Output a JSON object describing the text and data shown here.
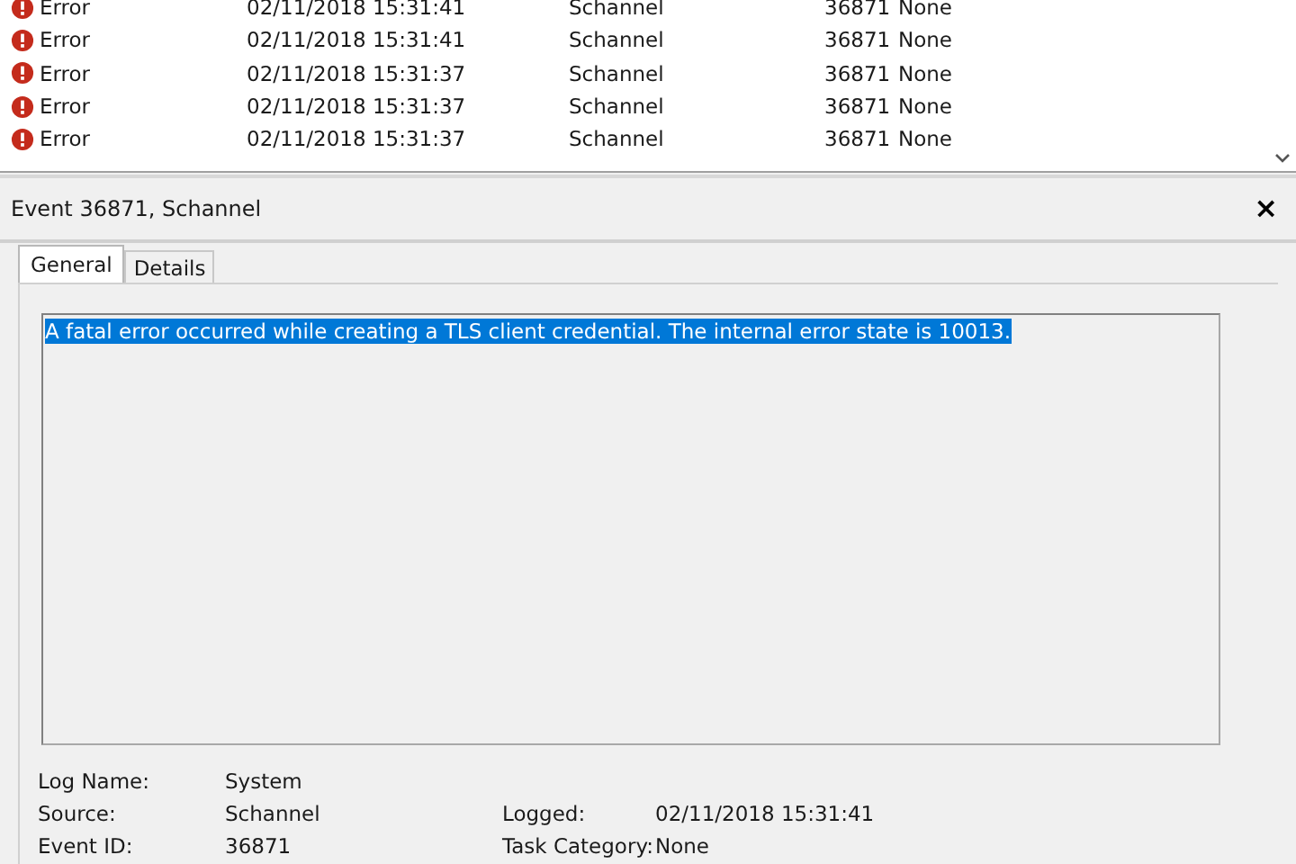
{
  "events": [
    {
      "level": "Error",
      "date": "02/11/2018 15:31:41",
      "source": "Schannel",
      "event_id": "36871",
      "task_category": "None"
    },
    {
      "level": "Error",
      "date": "02/11/2018 15:31:41",
      "source": "Schannel",
      "event_id": "36871",
      "task_category": "None"
    },
    {
      "level": "Error",
      "date": "02/11/2018 15:31:37",
      "source": "Schannel",
      "event_id": "36871",
      "task_category": "None"
    },
    {
      "level": "Error",
      "date": "02/11/2018 15:31:37",
      "source": "Schannel",
      "event_id": "36871",
      "task_category": "None"
    },
    {
      "level": "Error",
      "date": "02/11/2018 15:31:37",
      "source": "Schannel",
      "event_id": "36871",
      "task_category": "None"
    }
  ],
  "detail_panel": {
    "title": "Event 36871, Schannel",
    "close": "×",
    "tabs": [
      {
        "label": "General",
        "selected": true
      },
      {
        "label": "Details",
        "selected": false
      }
    ],
    "message": "A fatal error occurred while creating a TLS client credential. The internal error state is 10013.",
    "fields": [
      {
        "label": "Log Name:",
        "value": "System"
      },
      {
        "label": "Source:",
        "value": "Schannel"
      },
      {
        "label": "Logged:",
        "value": "02/11/2018 15:31:41"
      },
      {
        "label": "Event ID:",
        "value": "36871"
      },
      {
        "label": "Task Category:",
        "value": "None"
      }
    ]
  }
}
